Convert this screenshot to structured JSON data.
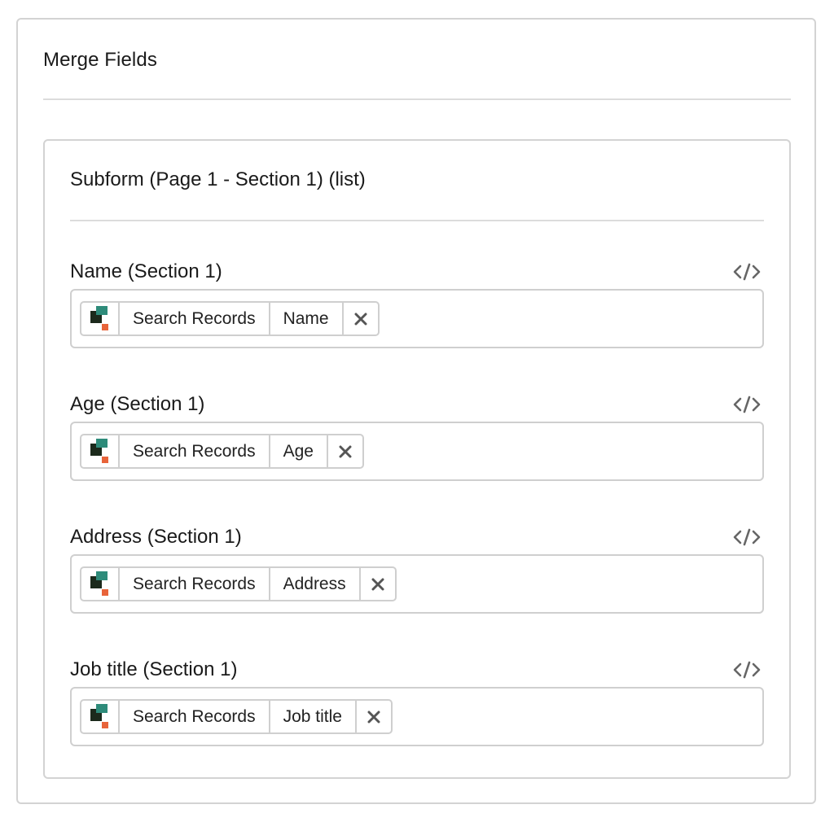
{
  "panel": {
    "title": "Merge Fields"
  },
  "subform": {
    "title": "Subform (Page 1 - Section 1) (list)",
    "fields": [
      {
        "label": "Name (Section 1)",
        "source": "Search Records",
        "value": "Name"
      },
      {
        "label": "Age (Section 1)",
        "source": "Search Records",
        "value": "Age"
      },
      {
        "label": "Address (Section 1)",
        "source": "Search Records",
        "value": "Address"
      },
      {
        "label": "Job title (Section 1)",
        "source": "Search Records",
        "value": "Job title"
      }
    ]
  },
  "icons": {
    "code": "code-icon",
    "remove": "close-icon",
    "logo": "app-logo-icon"
  },
  "colors": {
    "logo_green": "#2e8b7a",
    "logo_dark": "#1c2a1c",
    "logo_orange": "#e8643a",
    "icon_gray": "#666666",
    "border": "#cfcfcf"
  }
}
